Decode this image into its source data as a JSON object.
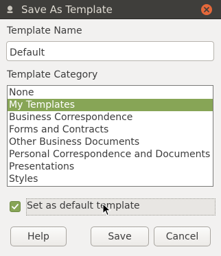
{
  "window": {
    "title": "Save As Template",
    "app_icon": "libreoffice-icon",
    "close_icon": "close-icon"
  },
  "template_name": {
    "label": "Template Name",
    "value": "Default"
  },
  "template_category": {
    "label": "Template Category",
    "items": [
      "None",
      "My Templates",
      "Business Correspondence",
      "Forms and Contracts",
      "Other Business Documents",
      "Personal Correspondence and Documents",
      "Presentations",
      "Styles"
    ],
    "selected": "My Templates"
  },
  "default_checkbox": {
    "label": "Set as default template",
    "checked": true
  },
  "buttons": {
    "help": "Help",
    "save": "Save",
    "cancel": "Cancel"
  },
  "colors": {
    "titlebar": "#3f3e3b",
    "close": "#e5683a",
    "selection": "#87a556"
  }
}
